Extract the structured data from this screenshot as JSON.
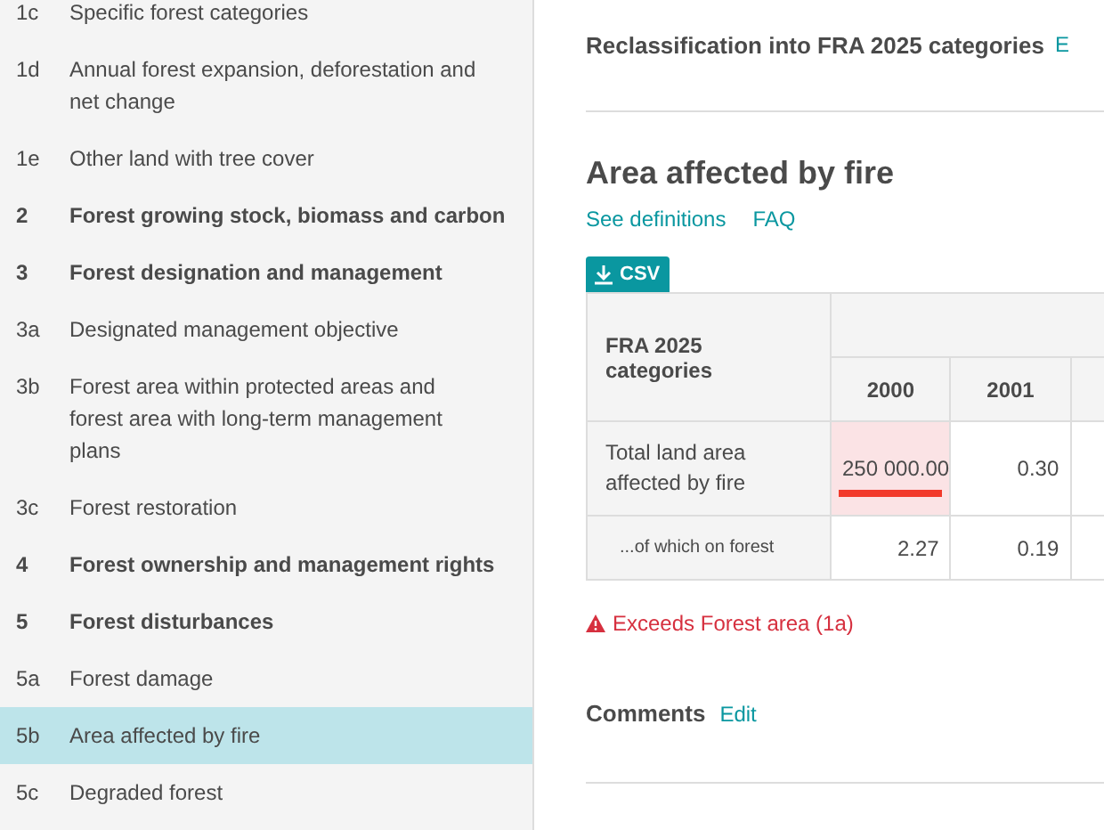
{
  "sidebar": {
    "items": [
      {
        "number": "1c",
        "label": "Specific forest categories",
        "kind": "section",
        "selected": false
      },
      {
        "number": "1d",
        "label": "Annual forest expansion, deforestation and net change",
        "kind": "section",
        "selected": false
      },
      {
        "number": "1e",
        "label": "Other land with tree cover",
        "kind": "section",
        "selected": false
      },
      {
        "number": "2",
        "label": "Forest growing stock, biomass and carbon",
        "kind": "chapter",
        "selected": false
      },
      {
        "number": "3",
        "label": "Forest designation and management",
        "kind": "chapter",
        "selected": false
      },
      {
        "number": "3a",
        "label": "Designated management objective",
        "kind": "section",
        "selected": false
      },
      {
        "number": "3b",
        "label": "Forest area within protected areas and forest area with long-term management plans",
        "kind": "section",
        "selected": false
      },
      {
        "number": "3c",
        "label": "Forest restoration",
        "kind": "section",
        "selected": false
      },
      {
        "number": "4",
        "label": "Forest ownership and management rights",
        "kind": "chapter",
        "selected": false
      },
      {
        "number": "5",
        "label": "Forest disturbances",
        "kind": "chapter",
        "selected": false
      },
      {
        "number": "5a",
        "label": "Forest damage",
        "kind": "section",
        "selected": false
      },
      {
        "number": "5b",
        "label": "Area affected by fire",
        "kind": "section",
        "selected": true
      },
      {
        "number": "5c",
        "label": "Degraded forest",
        "kind": "section",
        "selected": false
      }
    ]
  },
  "reclassification": {
    "title": "Reclassification into FRA 2025 categories",
    "link": "E"
  },
  "section": {
    "title": "Area affected by fire",
    "links": [
      "See definitions",
      "FAQ"
    ],
    "csv_button": "CSV"
  },
  "table": {
    "corner": "FRA 2025 categories",
    "columns": [
      "2000",
      "2001"
    ],
    "rows": [
      {
        "label": "Total land area affected by fire",
        "kind": "total",
        "cells": [
          {
            "value": "250 000.00",
            "error": true,
            "underlined": true
          },
          {
            "value": "0.30",
            "error": false,
            "underlined": false
          }
        ]
      },
      {
        "label": "...of which on forest",
        "kind": "sub",
        "cells": [
          {
            "value": "2.27",
            "error": false,
            "underlined": false
          },
          {
            "value": "0.19",
            "error": false,
            "underlined": false
          }
        ]
      }
    ]
  },
  "warning": "Exceeds Forest area (1a)",
  "comments": {
    "title": "Comments",
    "link": "Edit"
  }
}
